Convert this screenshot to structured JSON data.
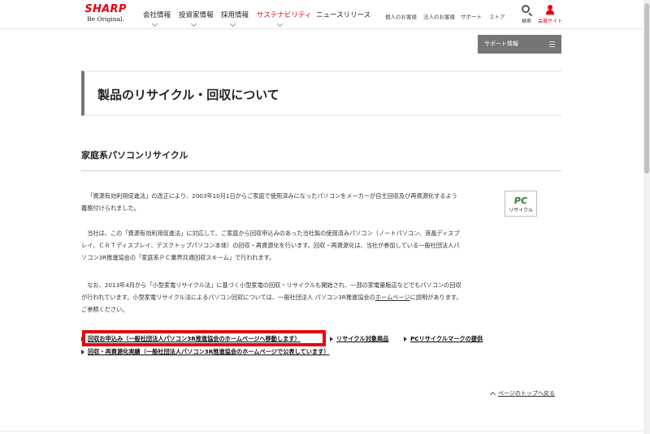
{
  "header": {
    "logo_word": "SHARP",
    "logo_tagline": "Be Original.",
    "nav": [
      "会社情報",
      "投資家情報",
      "採用情報",
      "サステナビリティ",
      "ニュースリリース"
    ],
    "active_nav": "サステナビリティ",
    "subnav": [
      "個人のお客様",
      "法人のお客様",
      "サポート",
      "ストア"
    ],
    "search_label": "検索",
    "member_label": "会員サイト"
  },
  "support_button": {
    "label": "サポート情報",
    "icon": "menu-icon"
  },
  "page_title": "製品のリサイクル・回収について",
  "section_heading": "家庭系パソコンリサイクル",
  "paragraphs": {
    "p1": "「資源有効利用促進法」の改正により、2003年10月1日からご家庭で使用済みになったパソコンをメーカーが自主回収及び再資源化するよう義務付けられました。",
    "p2": "当社は、この「資源有効利用促進法」に対応して、ご家庭から回収申込みのあった当社製の使用済みパソコン（ノートパソコン、液晶ディスプレイ、ＣＲＴディスプレイ、デスクトップパソコン本体）の回収・再資源化を行います。回収・再資源化は、当社が参加している一般社団法人パソコン3R推進協会の「家庭系ＰＣ業界共通回収スキーム」で行われます。",
    "p3_before_link": "なお、2013年4月から「小型家電リサイクル法」に基づく小型家電の回収・リサイクルも開始され、一部の家電量販店などでもパソコンの回収が行われています。小型家電リサイクル法によるパソコン回収については、一般社団法人 パソコン3R推進協会の",
    "p3_link": "ホームページ",
    "p3_after_link": "に説明があります。ご参照ください。"
  },
  "pc_recycle_logo": {
    "mark": "PC",
    "text": "リサイクル"
  },
  "links": {
    "apply": "回収お申込み（一般社団法人パソコン3R推進協会のホームページへ移動します）",
    "products": "リサイクル対象商品",
    "mark": "PCリサイクルマークの提供",
    "results": "回収・再資源化実績（一般社団法人パソコン3R推進協会のホームページで公表しています）"
  },
  "page_top": "ページのトップへ戻る",
  "colors": {
    "brand": "#e60012",
    "support_bg": "#757575",
    "highlight": "#e60012"
  }
}
